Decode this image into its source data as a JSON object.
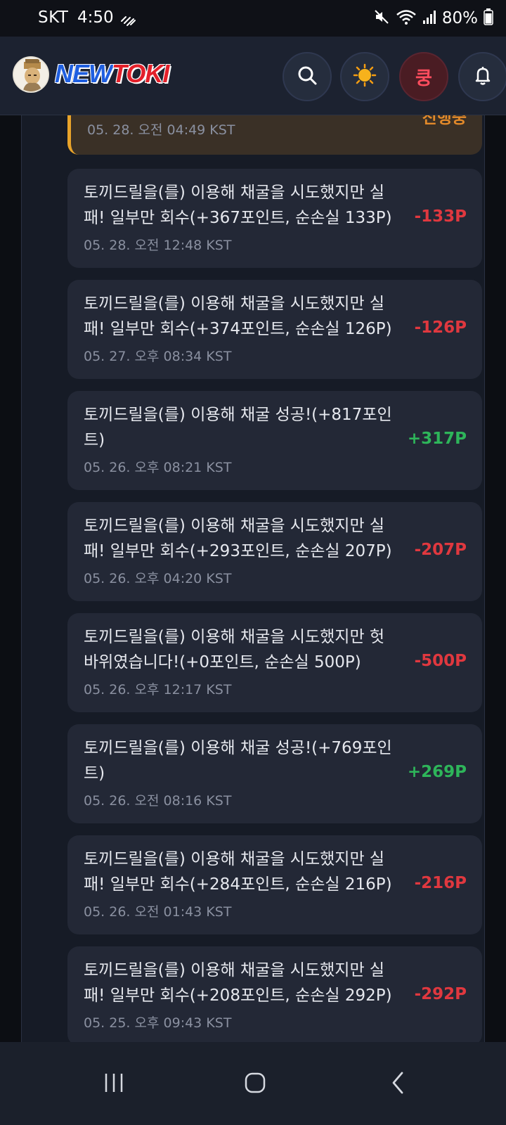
{
  "status_bar": {
    "carrier": "SKT",
    "time": "4:50",
    "battery": "80%"
  },
  "header": {
    "logo_part1": "NEW",
    "logo_part2": "TOKI",
    "kung_label": "쿵"
  },
  "partial_card": {
    "status": "진행중",
    "date": "05. 28. 오전 04:49 KST"
  },
  "history": [
    {
      "message": "토끼드릴을(를) 이용해 채굴을 시도했지만 실패! 일부만 회수(+367포인트, 순손실 133P)",
      "date": "05. 28. 오전 12:48 KST",
      "amount": "-133P",
      "type": "neg"
    },
    {
      "message": "토끼드릴을(를) 이용해 채굴을 시도했지만 실패! 일부만 회수(+374포인트, 순손실 126P)",
      "date": "05. 27. 오후 08:34 KST",
      "amount": "-126P",
      "type": "neg"
    },
    {
      "message": "토끼드릴을(를) 이용해 채굴 성공!(+817포인트)",
      "date": "05. 26. 오후 08:21 KST",
      "amount": "+317P",
      "type": "pos"
    },
    {
      "message": "토끼드릴을(를) 이용해 채굴을 시도했지만 실패! 일부만 회수(+293포인트, 순손실 207P)",
      "date": "05. 26. 오후 04:20 KST",
      "amount": "-207P",
      "type": "neg"
    },
    {
      "message": "토끼드릴을(를) 이용해 채굴을 시도했지만 헛바위였습니다!(+0포인트, 순손실 500P)",
      "date": "05. 26. 오후 12:17 KST",
      "amount": "-500P",
      "type": "neg"
    },
    {
      "message": "토끼드릴을(를) 이용해 채굴 성공!(+769포인트)",
      "date": "05. 26. 오전 08:16 KST",
      "amount": "+269P",
      "type": "pos"
    },
    {
      "message": "토끼드릴을(를) 이용해 채굴을 시도했지만 실패! 일부만 회수(+284포인트, 순손실 216P)",
      "date": "05. 26. 오전 01:43 KST",
      "amount": "-216P",
      "type": "neg"
    },
    {
      "message": "토끼드릴을(를) 이용해 채굴을 시도했지만 실패! 일부만 회수(+208포인트, 순손실 292P)",
      "date": "05. 25. 오후 09:43 KST",
      "amount": "-292P",
      "type": "neg"
    }
  ],
  "colors": {
    "negative": "#e0383f",
    "positive": "#2eb55a",
    "in_progress": "#e38a2a"
  },
  "icons": [
    "search-icon",
    "sun-icon",
    "bell-icon",
    "mute-icon",
    "wifi-icon",
    "signal-icon",
    "battery-icon",
    "recent-apps-icon",
    "home-icon",
    "back-icon"
  ]
}
